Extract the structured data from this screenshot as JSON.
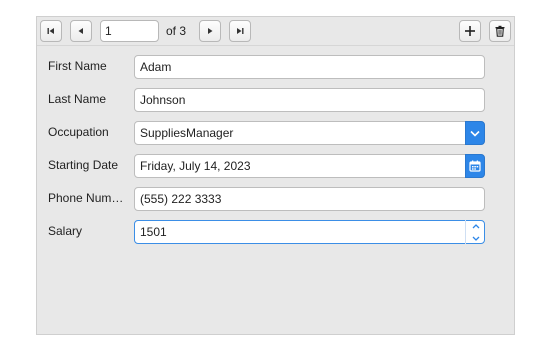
{
  "navigator": {
    "position_value": "1",
    "of_label": "of 3",
    "first_icon": "first-record-icon",
    "prev_icon": "previous-record-icon",
    "next_icon": "next-record-icon",
    "last_icon": "last-record-icon",
    "add_icon": "plus-icon",
    "delete_icon": "trash-icon"
  },
  "form": {
    "first_name": {
      "label": "First Name",
      "value": "Adam"
    },
    "last_name": {
      "label": "Last Name",
      "value": "Johnson"
    },
    "occupation": {
      "label": "Occupation",
      "value": "SuppliesManager"
    },
    "starting_date": {
      "label": "Starting Date",
      "value": "Friday, July 14, 2023"
    },
    "phone": {
      "label": "Phone  Num…",
      "value": "(555) 222 3333"
    },
    "salary": {
      "label": "Salary",
      "value": "1501"
    }
  },
  "colors": {
    "accent": "#2d86e8",
    "panel_background": "#e8e8e8",
    "focus_border": "#3b8ee6"
  }
}
